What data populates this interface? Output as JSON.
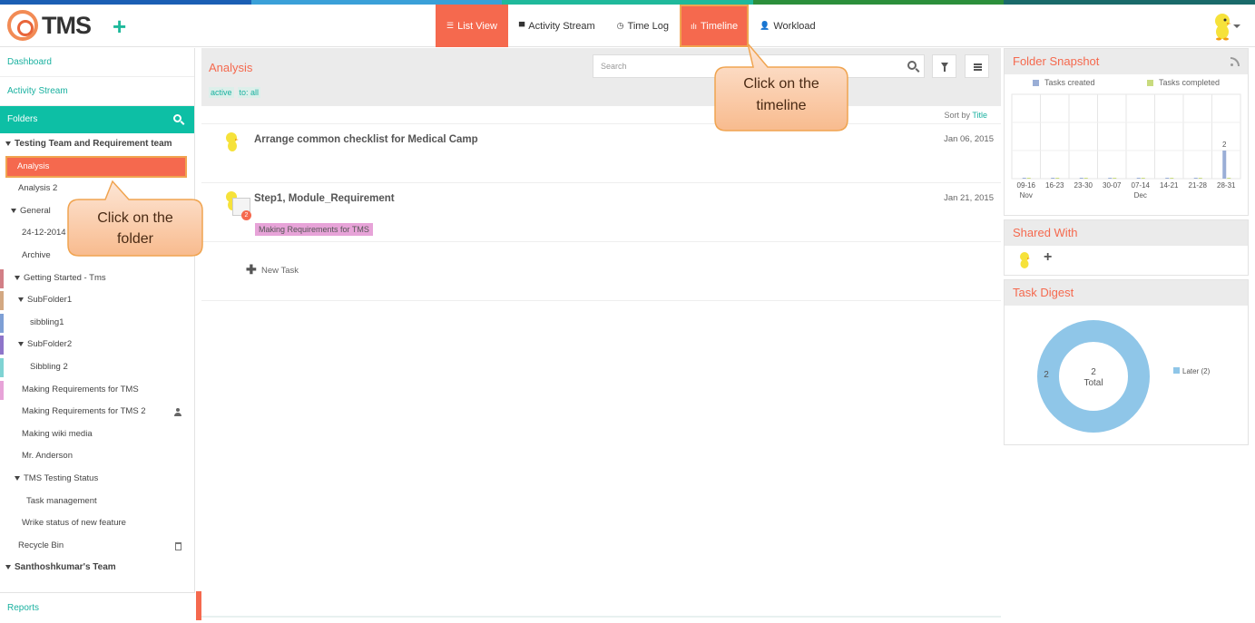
{
  "colors": {
    "accent": "#f5694e",
    "teal": "#0dbfa5",
    "teal_text": "#1ab1a0",
    "created": "#9aaed6",
    "completed": "#c9db7e",
    "later": "#8fc6e8",
    "strip": [
      "#1b5fb4",
      "#3aa0d8",
      "#1fb99b",
      "#2c8f3b",
      "#1a6a6a"
    ]
  },
  "header": {
    "logo_text": "TMS",
    "add_label": "+",
    "nav": [
      {
        "label": "List View",
        "icon": "list-icon",
        "glyph": "☰",
        "state": "active"
      },
      {
        "label": "Activity Stream",
        "icon": "comment-icon",
        "glyph": "▀",
        "state": ""
      },
      {
        "label": "Time Log",
        "icon": "clock-icon",
        "glyph": "◷",
        "state": ""
      },
      {
        "label": "Timeline",
        "icon": "timeline-icon",
        "glyph": "ılı",
        "state": "highlight"
      },
      {
        "label": "Workload",
        "icon": "user-icon",
        "glyph": "👤",
        "state": ""
      }
    ]
  },
  "sidebar": {
    "dashboard": "Dashboard",
    "activity_stream": "Activity Stream",
    "folders": "Folders",
    "reports": "Reports",
    "collapse_label": "III",
    "tree": [
      {
        "label": "Testing Team and Requirement team",
        "indent": 6,
        "tri": true,
        "bold": true
      },
      {
        "label": "Analysis",
        "indent": 12,
        "selected": true
      },
      {
        "label": "Analysis 2",
        "indent": 20
      },
      {
        "label": "General",
        "indent": 12,
        "tri": true
      },
      {
        "label": "24-12-2014",
        "indent": 24
      },
      {
        "label": "Archive",
        "indent": 24
      },
      {
        "label": "Getting Started - Tms",
        "indent": 16,
        "tri": true,
        "color": "#d27f86"
      },
      {
        "label": "SubFolder1",
        "indent": 20,
        "tri": true,
        "color": "#d3a882"
      },
      {
        "label": "sibbling1",
        "indent": 33,
        "color": "#7e9fd5"
      },
      {
        "label": "SubFolder2",
        "indent": 20,
        "tri": true,
        "color": "#8e75c9"
      },
      {
        "label": "Sibbling 2",
        "indent": 33,
        "color": "#7fd3d3"
      },
      {
        "label": "Making Requirements for TMS",
        "indent": 24,
        "color": "#e7a3d8"
      },
      {
        "label": "Making Requirements for TMS 2",
        "indent": 24,
        "user": true
      },
      {
        "label": "Making wiki media",
        "indent": 24
      },
      {
        "label": "Mr. Anderson",
        "indent": 24
      },
      {
        "label": "TMS Testing Status",
        "indent": 16,
        "tri": true
      },
      {
        "label": "Task management",
        "indent": 29
      },
      {
        "label": "Wrike status of new feature",
        "indent": 24
      },
      {
        "label": "Recycle Bin",
        "indent": 20,
        "trash": true
      },
      {
        "label": "Santhoshkumar's Team",
        "indent": 6,
        "tri": true,
        "bold": true
      }
    ]
  },
  "main": {
    "title": "Analysis",
    "filters": [
      "active",
      "to: all"
    ],
    "search_placeholder": "Search",
    "sort_prefix": "Sort by",
    "sort_field": "Title",
    "tasks": [
      {
        "title": "Arrange common checklist for Medical Camp",
        "date": "Jan 06, 2015",
        "tag": "",
        "badge": ""
      },
      {
        "title": "Step1, Module_Requirement",
        "date": "Jan 21, 2015",
        "tag": "Making Requirements for TMS",
        "badge": "2"
      }
    ],
    "new_task_label": "New Task"
  },
  "callouts": {
    "timeline": "Click on the timeline",
    "folder": "Click on the folder"
  },
  "snapshot": {
    "title": "Folder Snapshot",
    "legend_created": "Tasks created",
    "legend_completed": "Tasks completed",
    "chart_data": {
      "type": "bar",
      "categories": [
        "09-16",
        "16-23",
        "23-30",
        "30-07",
        "07-14",
        "14-21",
        "21-28",
        "28-31"
      ],
      "month_labels": [
        "Nov",
        "",
        "",
        "",
        "Dec",
        "",
        "",
        ""
      ],
      "series": [
        {
          "name": "Tasks created",
          "values": [
            0,
            0,
            0,
            0,
            0,
            0,
            0,
            2
          ]
        },
        {
          "name": "Tasks completed",
          "values": [
            0,
            0,
            0,
            0,
            0,
            0,
            0,
            0
          ]
        }
      ],
      "ylim": [
        0,
        6
      ],
      "data_labels": [
        "",
        "",
        "",
        "",
        "",
        "",
        "",
        "2"
      ]
    }
  },
  "shared": {
    "title": "Shared With",
    "add_label": "+"
  },
  "digest": {
    "title": "Task Digest",
    "chart_data": {
      "type": "pie",
      "labels": [
        "Later"
      ],
      "values": [
        2
      ],
      "legend": [
        "Later (2)"
      ],
      "center_value": "2",
      "center_label": "Total",
      "side_label": "2"
    }
  }
}
